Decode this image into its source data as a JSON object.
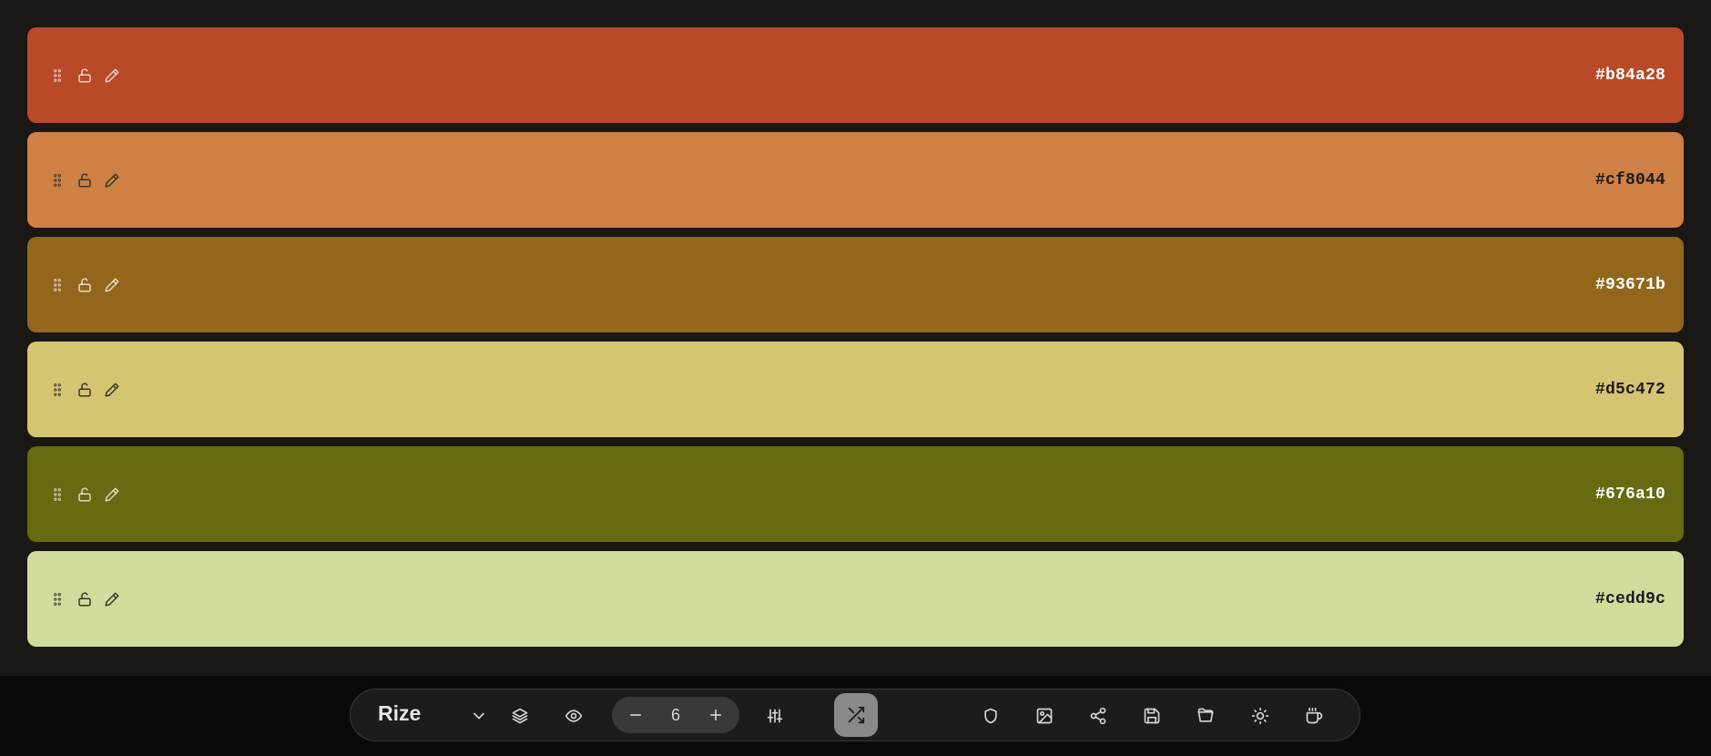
{
  "palette": {
    "swatches": [
      {
        "hex": "#b84a28",
        "tone": "dark"
      },
      {
        "hex": "#cf8044",
        "tone": "light"
      },
      {
        "hex": "#93671b",
        "tone": "dark"
      },
      {
        "hex": "#d5c472",
        "tone": "light"
      },
      {
        "hex": "#676a10",
        "tone": "dark"
      },
      {
        "hex": "#cedd9c",
        "tone": "light"
      }
    ]
  },
  "toolbar": {
    "brand": "Rize",
    "color_count": "6",
    "icons": {
      "dropdown": "chevron-down-icon",
      "layers": "layers-icon",
      "preview": "eye-icon",
      "decrease": "minus-icon",
      "increase": "plus-icon",
      "adjust": "sliders-icon",
      "shuffle": "shuffle-icon",
      "contrast": "shield-icon",
      "image": "image-icon",
      "share": "share-icon",
      "save": "save-icon",
      "open": "folder-open-icon",
      "theme": "sun-icon",
      "donate": "coffee-icon"
    }
  }
}
